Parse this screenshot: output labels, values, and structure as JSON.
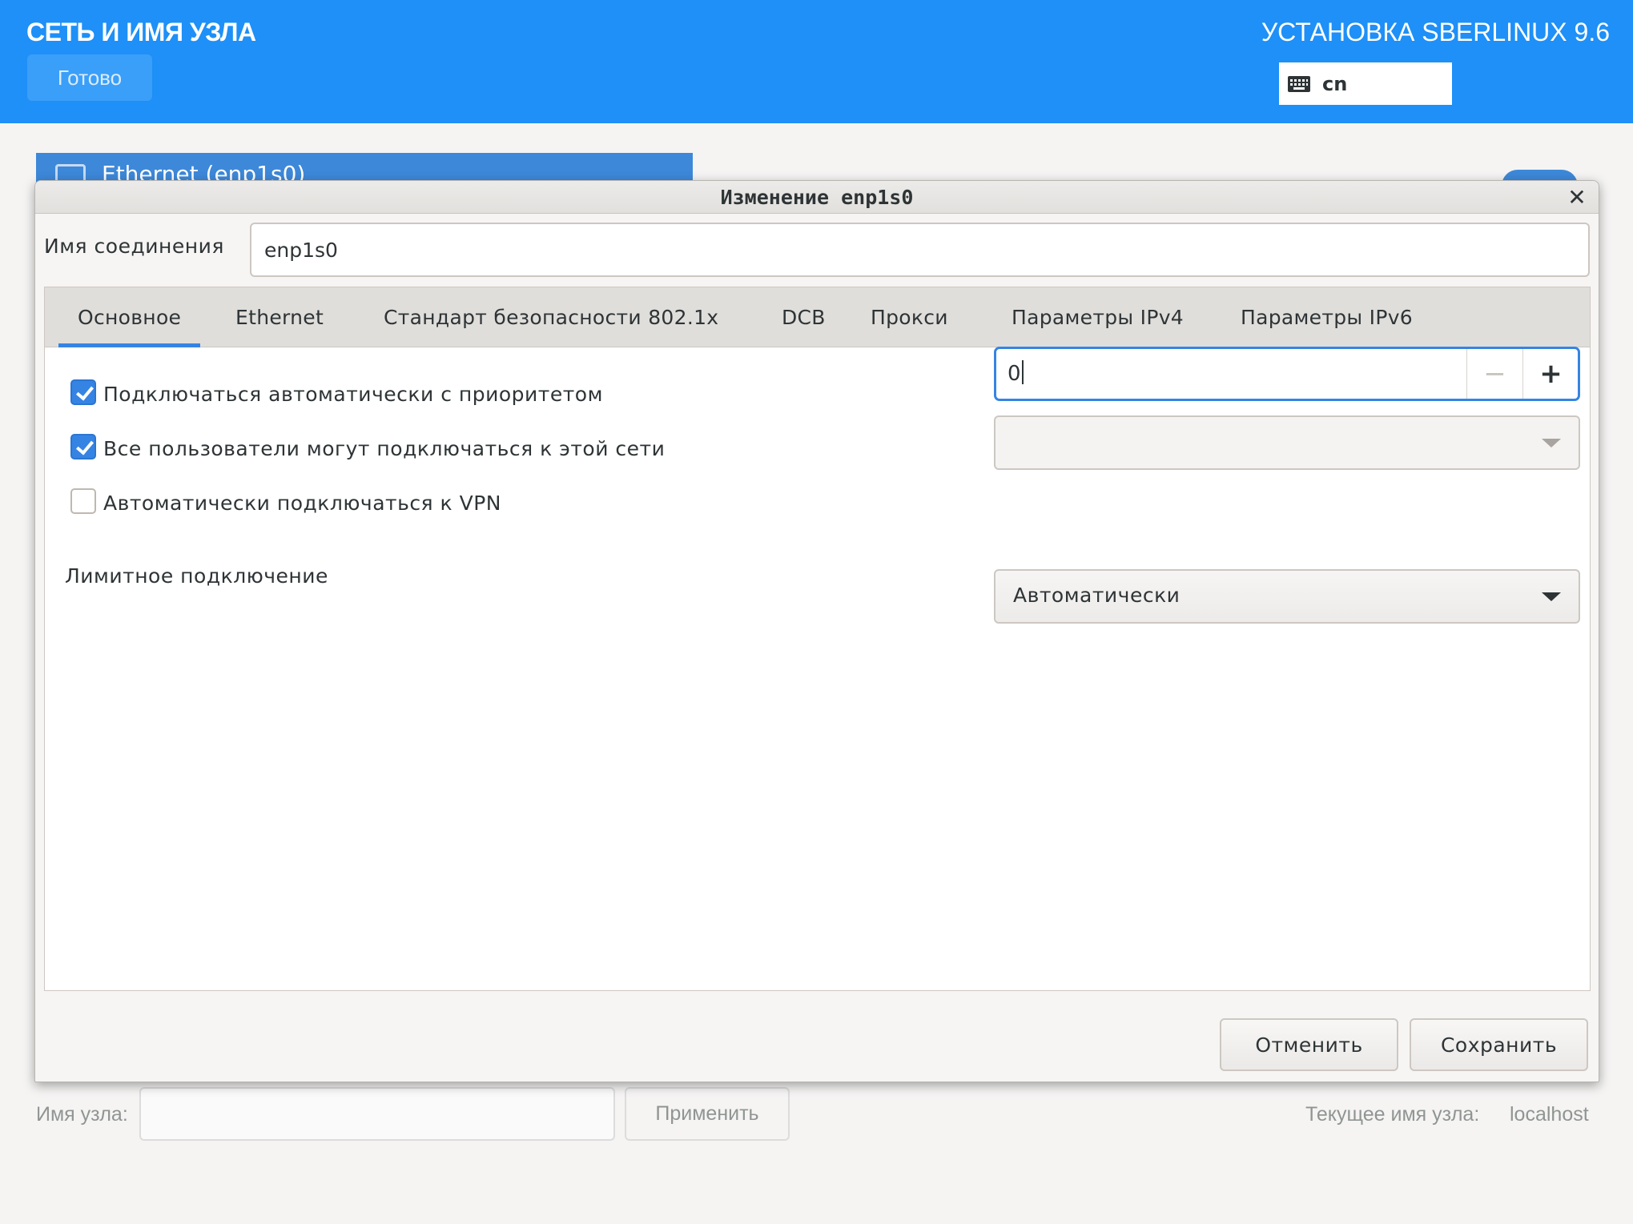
{
  "header": {
    "title": "СЕТЬ И ИМЯ УЗЛА",
    "done_label": "Готово",
    "product": "УСТАНОВКА SBERLINUX 9.6",
    "keyboard_layout": "cn",
    "accent_color": "#1e90f7"
  },
  "background": {
    "device_label": "Ethernet (enp1s0)",
    "hostname_label": "Имя узла:",
    "hostname_value": "",
    "apply_label": "Применить",
    "current_hostname_label": "Текущее имя узла:",
    "current_hostname_value": "localhost"
  },
  "dialog": {
    "title": "Изменение enp1s0",
    "close_icon": "close-icon",
    "connection_name_label": "Имя соединения",
    "connection_name_value": "enp1s0",
    "tabs": [
      {
        "label": "Основное",
        "active": true
      },
      {
        "label": "Ethernet"
      },
      {
        "label": "Стандарт безопасности 802.1x"
      },
      {
        "label": "DCB"
      },
      {
        "label": "Прокси"
      },
      {
        "label": "Параметры IPv4"
      },
      {
        "label": "Параметры IPv6"
      }
    ],
    "general": {
      "auto_connect": {
        "label": "Подключаться автоматически с приоритетом",
        "checked": true
      },
      "priority_value": "0",
      "all_users": {
        "label": "Все пользователи могут подключаться к этой сети",
        "checked": true
      },
      "auto_vpn": {
        "label": "Автоматически подключаться к VPN",
        "checked": false
      },
      "vpn_selected": "",
      "metered_label": "Лимитное подключение",
      "metered_value": "Автоматически"
    },
    "cancel_label": "Отменить",
    "save_label": "Сохранить"
  }
}
